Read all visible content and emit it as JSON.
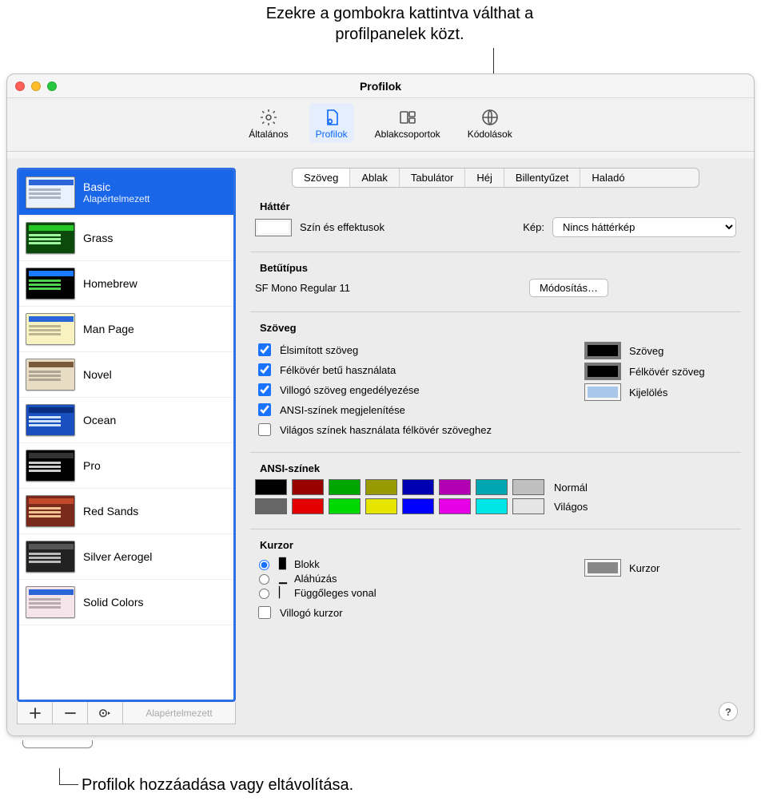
{
  "callouts": {
    "top": "Ezekre a gombokra kattintva válthat a profilpanelek közt.",
    "bottom": "Profilok hozzáadása vagy eltávolítása."
  },
  "window": {
    "title": "Profilok"
  },
  "toolbar": {
    "general": "Általános",
    "profiles": "Profilok",
    "groups": "Ablakcsoportok",
    "encodings": "Kódolások"
  },
  "sidebar": {
    "profiles": [
      {
        "name": "Basic",
        "subtitle": "Alapértelmezett",
        "thumb": "blue",
        "selected": true
      },
      {
        "name": "Grass",
        "thumb": "green"
      },
      {
        "name": "Homebrew",
        "thumb": "dark"
      },
      {
        "name": "Man Page",
        "thumb": "yellow"
      },
      {
        "name": "Novel",
        "thumb": "tan"
      },
      {
        "name": "Ocean",
        "thumb": "ocean"
      },
      {
        "name": "Pro",
        "thumb": "pro"
      },
      {
        "name": "Red Sands",
        "thumb": "red"
      },
      {
        "name": "Silver Aerogel",
        "thumb": "silver"
      },
      {
        "name": "Solid Colors",
        "thumb": "pink"
      }
    ],
    "footer_default": "Alapértelmezett"
  },
  "tabs": {
    "text": "Szöveg",
    "window": "Ablak",
    "tab": "Tabulátor",
    "shell": "Héj",
    "keyboard": "Billentyűzet",
    "advanced": "Haladó"
  },
  "background": {
    "heading": "Háttér",
    "color_effects": "Szín és effektusok",
    "image_label": "Kép:",
    "image_value": "Nincs háttérkép"
  },
  "font": {
    "heading": "Betűtípus",
    "value": "SF Mono Regular 11",
    "change": "Módosítás…"
  },
  "text": {
    "heading": "Szöveg",
    "opt1": "Élsimított szöveg",
    "opt2": "Félkövér betű használata",
    "opt3": "Villogó szöveg engedélyezése",
    "opt4": "ANSI-színek megjelenítése",
    "opt5": "Világos színek használata félkövér szöveghez",
    "label_text": "Szöveg",
    "label_bold": "Félkövér szöveg",
    "label_sel": "Kijelölés"
  },
  "ansi": {
    "heading": "ANSI-színek",
    "normal": "Normál",
    "bright": "Világos",
    "normal_colors": [
      "#000000",
      "#990000",
      "#00a600",
      "#999900",
      "#0000b2",
      "#b200b2",
      "#00a6b2",
      "#bfbfbf"
    ],
    "bright_colors": [
      "#666666",
      "#e50000",
      "#00d900",
      "#e5e500",
      "#0000ff",
      "#e500e5",
      "#00e5e5",
      "#e5e5e5"
    ]
  },
  "cursor": {
    "heading": "Kurzor",
    "block": "Blokk",
    "underline": "Aláhúzás",
    "vbar": "Függőleges vonal",
    "blink": "Villogó kurzor",
    "label": "Kurzor"
  },
  "help": "?"
}
